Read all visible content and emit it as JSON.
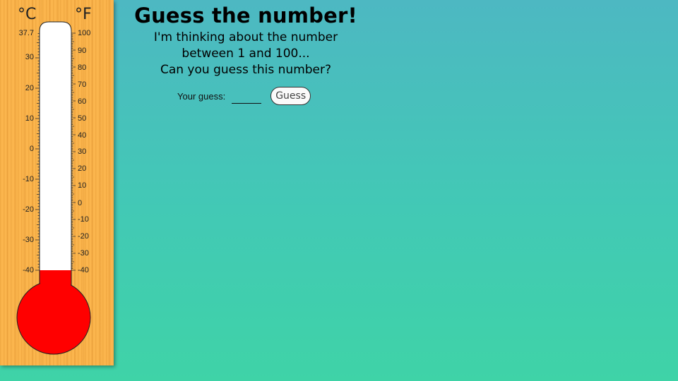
{
  "header": {
    "title": "Guess the number!",
    "subtitle_line1": "I'm thinking about the number",
    "subtitle_line2": "between 1 and 100...",
    "subtitle_line3": "Can you guess this number?"
  },
  "guess_form": {
    "label": "Your guess:",
    "input_value": "",
    "button_label": "Guess"
  },
  "thermometer": {
    "celsius_unit": "°C",
    "fahrenheit_unit": "°F",
    "celsius_labels": [
      "37.7",
      "30",
      "20",
      "10",
      "0",
      "-10",
      "-20",
      "-30",
      "-40"
    ],
    "fahrenheit_labels": [
      "100",
      "90",
      "80",
      "70",
      "60",
      "50",
      "40",
      "30",
      "20",
      "10",
      "0",
      "-10",
      "-20",
      "-30",
      "-40"
    ],
    "mercury_level_fraction": 0.0,
    "colors": {
      "panel": "#fbb54d",
      "mercury": "#ff0000",
      "tube": "#ffffff"
    }
  }
}
